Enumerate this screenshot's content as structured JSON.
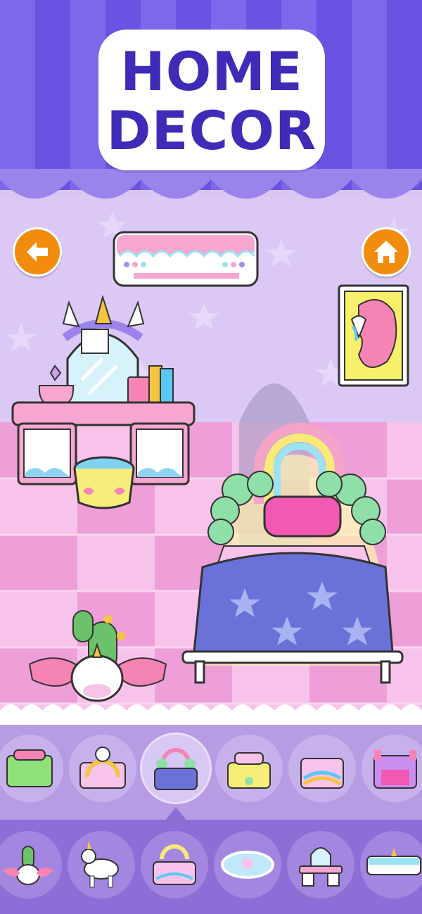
{
  "title": {
    "line1": "HOME",
    "line2": "DECOR"
  },
  "colors": {
    "title_text": "#3e2bb8",
    "curtain": "#6b52e3",
    "curtain_hem": "#9a84ec",
    "wall": "#dcc8f5",
    "floor": "#f4b6e4",
    "nav_button": "#f28c0c",
    "tray_top": "#b79be3",
    "tray_bottom": "#8d6dd6"
  },
  "nav": {
    "back_icon": "back-arrow-icon",
    "home_icon": "home-icon"
  },
  "scene_items": [
    "air-conditioner",
    "vanity-table",
    "unicorn-portrait",
    "stool",
    "rainbow-bed",
    "unicorn-planter"
  ],
  "bed_options": [
    "green-bed",
    "rainbow-unicorn-bed",
    "rainbow-cloud-bed",
    "unicorn-star-bed",
    "pink-rainbow-bed",
    "purple-castle-bed"
  ],
  "bed_options_selected_index": 2,
  "categories": [
    "plant",
    "unicorn-toy",
    "bed",
    "rug",
    "vanity",
    "air-conditioner"
  ]
}
